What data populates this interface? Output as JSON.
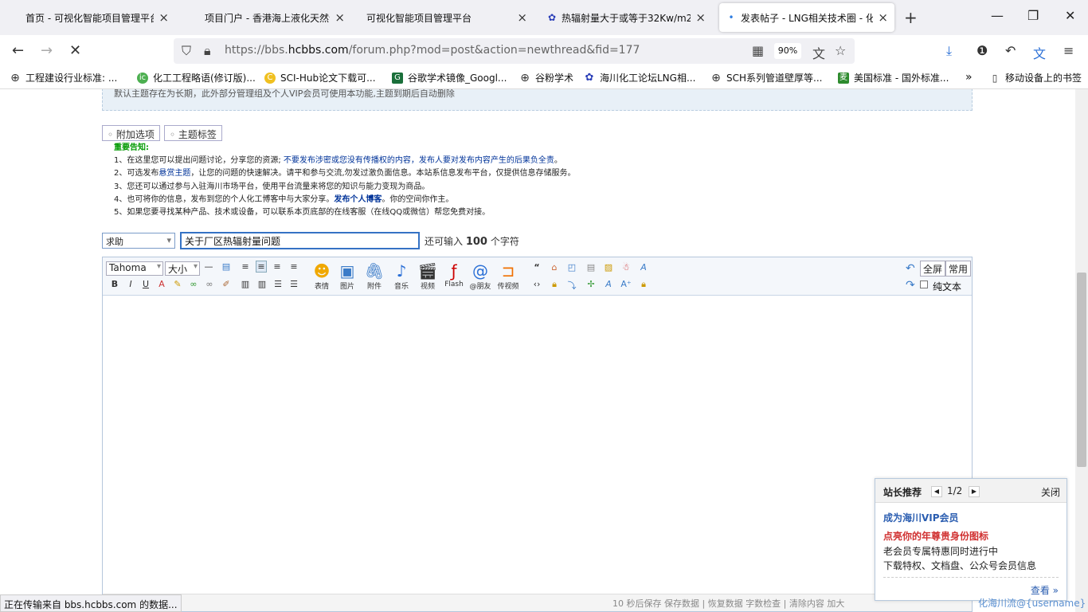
{
  "tabs": [
    {
      "title": "首页 - 可视化智能项目管理平台",
      "close": "×"
    },
    {
      "title": "项目门户 - 香港海上液化天然气",
      "close": "×"
    },
    {
      "title": "可视化智能项目管理平台",
      "close": "×"
    },
    {
      "title": "热辐射量大于或等于32Kw/m2",
      "close": "×"
    },
    {
      "title": "发表帖子 - LNG相关技术圈 - 化",
      "close": "×"
    }
  ],
  "newtab": "+",
  "url": {
    "prefix": "https://bbs.",
    "domain": "hcbbs.com",
    "path": "/forum.php?mod=post&action=newthread&fid=177"
  },
  "zoom": "90%",
  "bookmarks": [
    {
      "label": "工程建设行业标准: ..."
    },
    {
      "label": "化工工程略语(修订版)..."
    },
    {
      "label": "SCI-Hub论文下载可..."
    },
    {
      "label": "谷歌学术镜像_Googl..."
    },
    {
      "label": "谷粉学术"
    },
    {
      "label": "海川化工论坛LNG相..."
    },
    {
      "label": "SCH系列管道壁厚等..."
    },
    {
      "label": "美国标准 - 国外标准..."
    },
    {
      "label": "移动设备上的书签"
    }
  ],
  "top_note": "默认主题存在为长期，此外部分管理组及个人VIP会员可使用本功能,主题到期后自动删除",
  "option_tabs": [
    "附加选项",
    "主题标签"
  ],
  "notice": {
    "heading": "重要告知:",
    "l1a": "1、在这里您可以提出问题讨论，分享您的资源; ",
    "l1b": "不要发布涉密或您没有传播权的内容，发布人要对发布内容产生的后果负全责",
    "l1c": "。",
    "l2a": "2、可选发布",
    "l2b": "悬赏主题",
    "l2c": "，让您的问题的快速解决。请平和参与交流,勿发过激负面信息。本站系信息发布平台，仅提供信息存储服务。",
    "l3": "3、您还可以通过参与入驻海川市场平台，使用平台流量来将您的知识与能力变现为商品。",
    "l4a": "4、也可将你的信息，发布到您的个人化工博客中与大家分享。",
    "l4b": "发布个人博客",
    "l4c": "。你的空间你作主。",
    "l5": "5、如果您要寻找某种产品、技术或设备，可以联系本页底部的在线客服（在线QQ或微信）帮您免费对接。"
  },
  "post": {
    "type_selected": "求助",
    "subject_value": "关于厂区热辐射量问题",
    "remain_prefix": "还可输入",
    "remain_count": "100",
    "remain_suffix": "个字符"
  },
  "toolbar": {
    "font": "Tahoma",
    "size": "大小",
    "buttons": [
      "表情",
      "图片",
      "附件",
      "音乐",
      "视频",
      "Flash",
      "@朋友",
      "传视频"
    ],
    "fullscreen": "全屏",
    "common": "常用",
    "plaintext": "纯文本"
  },
  "editor_status": "10 秒后保存 保存数据 | 恢复数据    字数检查 | 清除内容    加大",
  "popup": {
    "title": "站长推荐",
    "page": "1/2",
    "close": "关闭",
    "line1": "成为海川VIP会员",
    "line2": "点亮你的年尊贵身份图标",
    "line3": "老会员专属特惠同时进行中",
    "line4": "下载特权、文档盘、公众号会员信息",
    "view": "查看 »"
  },
  "load_status": "正在传输来自 bbs.hcbbs.com 的数据...",
  "watermark": "化海川流@{username}"
}
